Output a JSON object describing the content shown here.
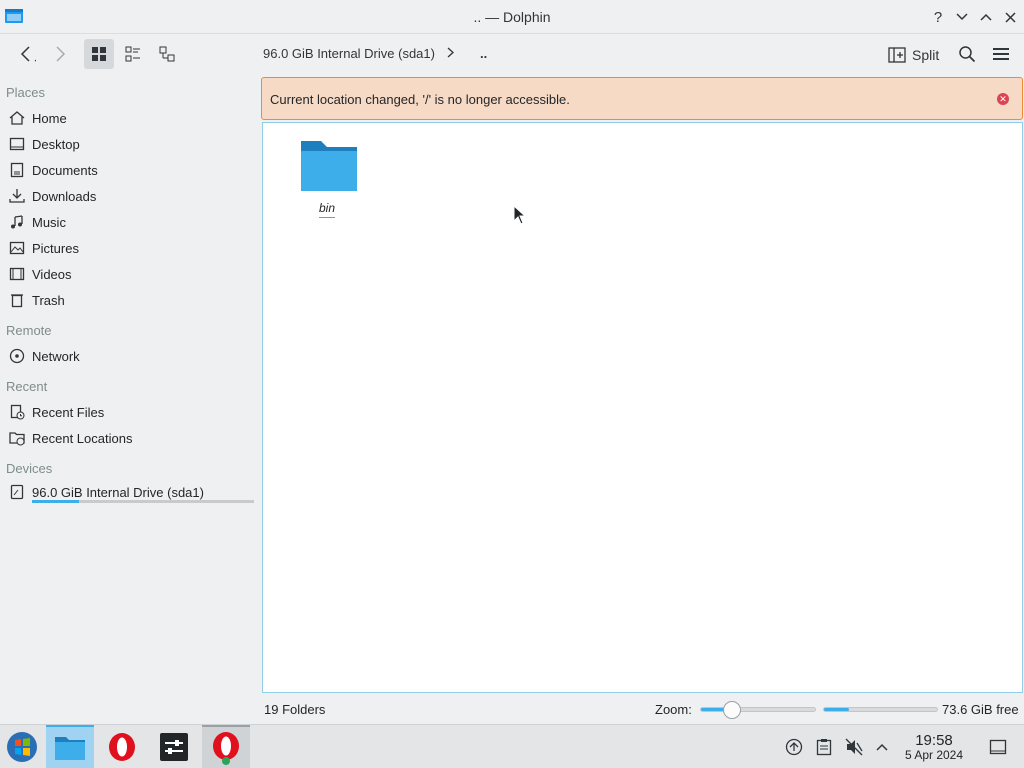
{
  "window": {
    "title": ".. — Dolphin",
    "buttons": {
      "help": "?"
    }
  },
  "toolbar": {
    "breadcrumb": [
      "96.0 GiB Internal Drive (sda1)",
      ".."
    ],
    "breadcrumb_separator": ">",
    "split_label": "Split",
    "active_view_mode": "icons"
  },
  "sidebar": {
    "sections": {
      "places": "Places",
      "remote": "Remote",
      "recent": "Recent",
      "devices": "Devices"
    },
    "places": [
      {
        "label": "Home",
        "icon": "home-icon"
      },
      {
        "label": "Desktop",
        "icon": "desktop-icon"
      },
      {
        "label": "Documents",
        "icon": "documents-icon"
      },
      {
        "label": "Downloads",
        "icon": "downloads-icon"
      },
      {
        "label": "Music",
        "icon": "music-icon"
      },
      {
        "label": "Pictures",
        "icon": "pictures-icon"
      },
      {
        "label": "Videos",
        "icon": "videos-icon"
      },
      {
        "label": "Trash",
        "icon": "trash-icon"
      }
    ],
    "remote": [
      {
        "label": "Network",
        "icon": "network-icon"
      }
    ],
    "recent": [
      {
        "label": "Recent Files",
        "icon": "recent-files-icon"
      },
      {
        "label": "Recent Locations",
        "icon": "recent-locations-icon"
      }
    ],
    "devices": [
      {
        "label": "96.0 GiB Internal Drive (sda1)",
        "icon": "drive-icon",
        "usage_fraction": 0.21
      }
    ]
  },
  "notification": {
    "message": "Current location changed, '/' is no longer accessible."
  },
  "view": {
    "items": [
      {
        "name": "bin",
        "type": "folder"
      }
    ]
  },
  "statusbar": {
    "count": "19 Folders",
    "zoom_label": "Zoom:",
    "zoom_fraction": 0.28,
    "free_space": "73.6 GiB free",
    "used_fraction": 0.22
  },
  "taskbar": {
    "apps": [
      "start-menu",
      "dolphin",
      "opera",
      "system-settings",
      "opera"
    ],
    "clock_time": "19:58",
    "clock_date": "5 Apr 2024"
  },
  "colors": {
    "accent": "#3daee9",
    "warning_bg": "#f6dac5",
    "warning_border": "#f08b33",
    "folder": "#3daee9"
  }
}
